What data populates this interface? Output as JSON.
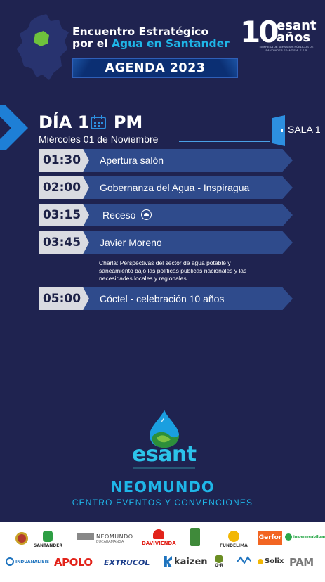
{
  "header": {
    "title_line1": "Encuentro Estratégico",
    "title_line2_prefix": "por el ",
    "title_line2_accent": "Agua en Santander",
    "logo_number": "10",
    "logo_word": "esant",
    "logo_anos": "años",
    "logo_sub": "Empresa de Servicios Públicos de Santander ESANT S.A. E.S.P.",
    "banner": "AGENDA 2023"
  },
  "day": {
    "title_prefix": "DÍA 1",
    "title_suffix": "PM",
    "date": "Miércoles 01 de Noviembre",
    "room": "SALA 1"
  },
  "agenda": [
    {
      "time": "01:30",
      "label": "Apertura salón"
    },
    {
      "time": "02:00",
      "label": "Gobernanza del Agua - Inspiragua"
    },
    {
      "time": "03:15",
      "label": "Receso"
    },
    {
      "time": "03:45",
      "label": "Javier Moreno"
    },
    {
      "time": "05:00",
      "label": "Cóctel - celebración 10 años"
    }
  ],
  "talk_description": "Charla: Perspectivas del sector de agua potable y saneamiento bajo las políticas públicas nacionales y las necesidades locales y regionales",
  "brand": {
    "logo_word": "esant",
    "venue": "NEOMUNDO",
    "venue_sub": "CENTRO EVENTOS  Y CONVENCIONES"
  },
  "sponsors": {
    "santander": "SANTANDER",
    "neomundo_top": "NEOMUNDO",
    "neomundo_sub": "BUCARAMANGA",
    "davivienda": "DAVIVIENDA",
    "fundelima": "FUNDELIMA",
    "gerfor": "Gerfor",
    "impermeabilizantes": "impermeabilizante",
    "indunanalisis": "INDUANALISIS",
    "apolo": "APOLO",
    "extrucol": "EXTRUCOL",
    "kaizen": "kaizen",
    "gr": "G·R",
    "solix": "Solix",
    "pam": "PAM"
  },
  "colors": {
    "background": "#1f2350",
    "accent_cyan": "#1fb6e8",
    "row_bar": "#2f4b8c",
    "time_box": "#d9dbe1"
  }
}
